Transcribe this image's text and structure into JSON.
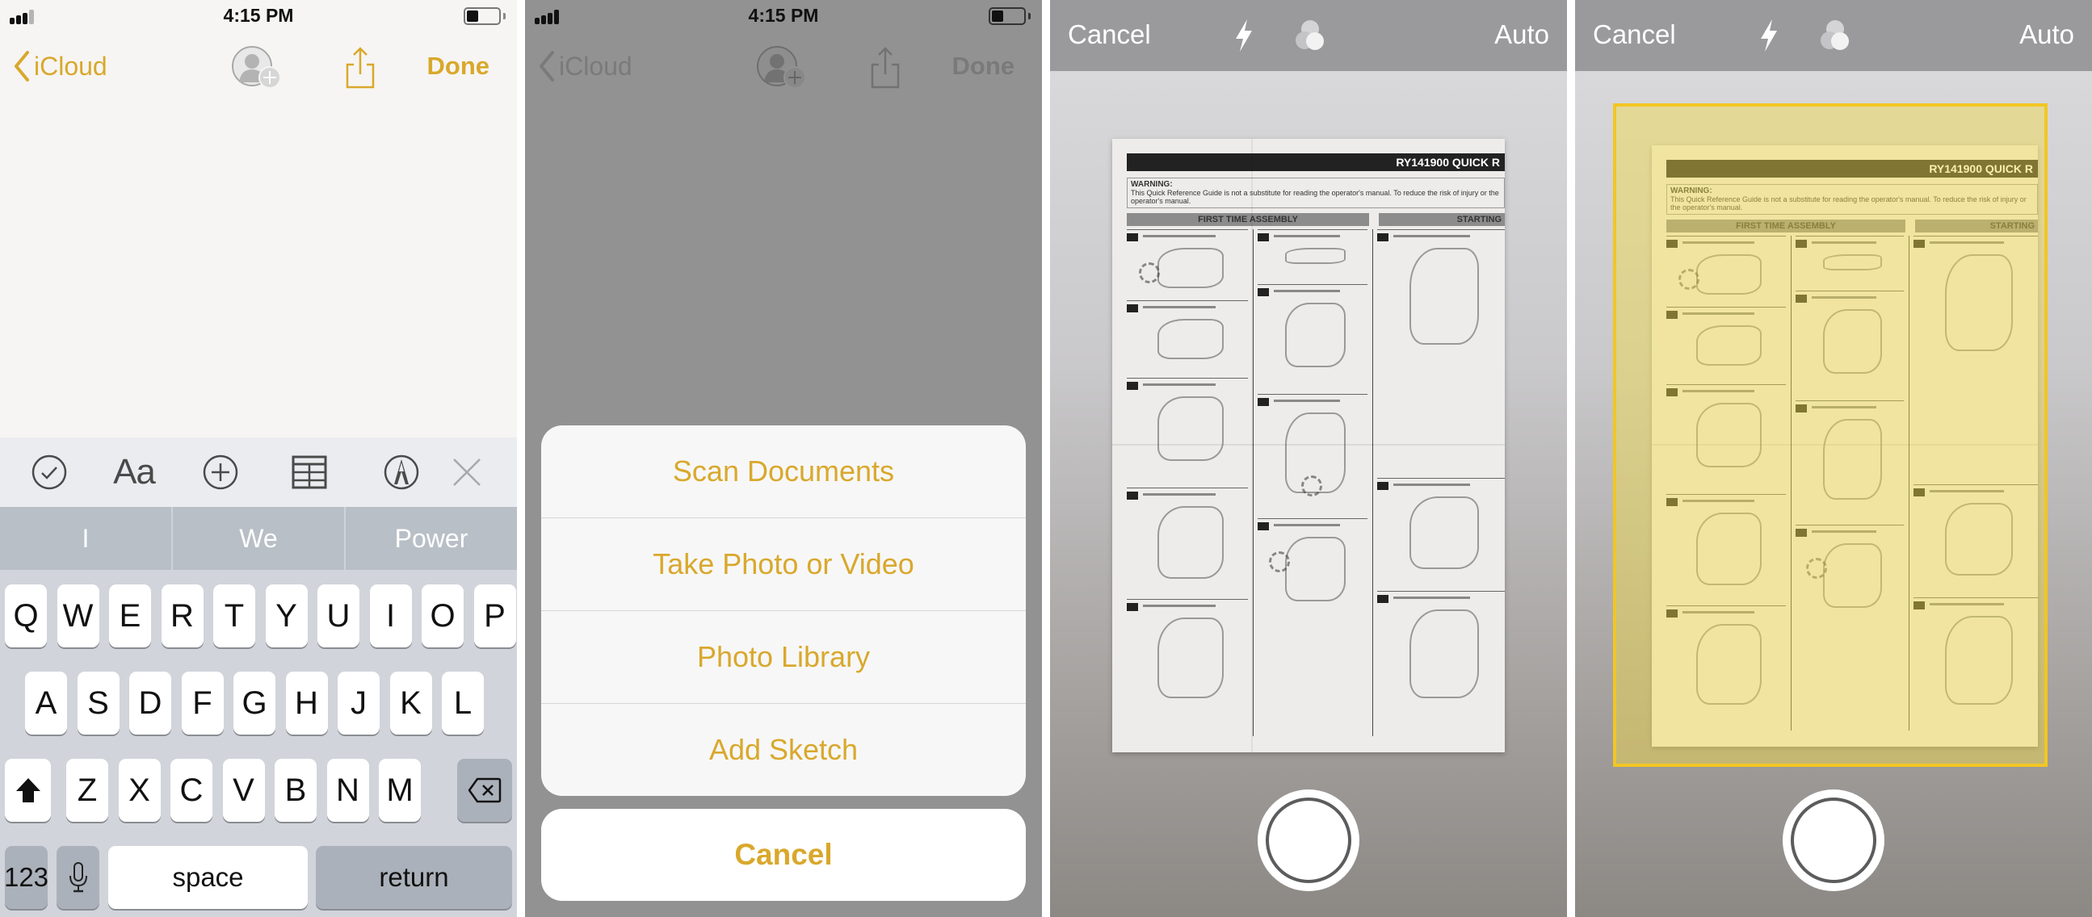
{
  "accent_color": "#d9a82c",
  "status_bar": {
    "time": "4:15 PM",
    "signal_bars_filled": 3,
    "signal_bars_total": 4,
    "battery_level_percent": 30
  },
  "notes_nav": {
    "back_label": "iCloud",
    "done_label": "Done",
    "icons": [
      "chevron-left-icon",
      "add-person-icon",
      "share-icon"
    ]
  },
  "format_toolbar": {
    "items": [
      {
        "name": "checklist",
        "icon": "checkmark-circle-icon"
      },
      {
        "name": "text-style",
        "label": "Aa"
      },
      {
        "name": "add",
        "icon": "plus-circle-icon"
      },
      {
        "name": "table",
        "icon": "table-icon"
      },
      {
        "name": "markup",
        "icon": "pen-circle-icon"
      },
      {
        "name": "close",
        "icon": "close-icon"
      }
    ]
  },
  "suggestions": [
    "I",
    "We",
    "Power"
  ],
  "keyboard": {
    "row1": [
      "Q",
      "W",
      "E",
      "R",
      "T",
      "Y",
      "U",
      "I",
      "O",
      "P"
    ],
    "row2": [
      "A",
      "S",
      "D",
      "F",
      "G",
      "H",
      "J",
      "K",
      "L"
    ],
    "row3": [
      "Z",
      "X",
      "C",
      "V",
      "B",
      "N",
      "M"
    ],
    "numbers_label": "123",
    "space_label": "space",
    "return_label": "return"
  },
  "action_sheet": {
    "items": [
      "Scan Documents",
      "Take Photo or Video",
      "Photo Library",
      "Add Sketch"
    ],
    "cancel_label": "Cancel"
  },
  "camera": {
    "cancel_label": "Cancel",
    "mode_label": "Auto",
    "document": {
      "title": "RY141900 QUICK R",
      "warning_title": "WARNING:",
      "warning_text": "This Quick Reference Guide is not a substitute for reading the operator's manual. To reduce the risk of injury or the operator's manual.",
      "section_left": "FIRST TIME ASSEMBLY",
      "section_right": "STARTING"
    }
  }
}
